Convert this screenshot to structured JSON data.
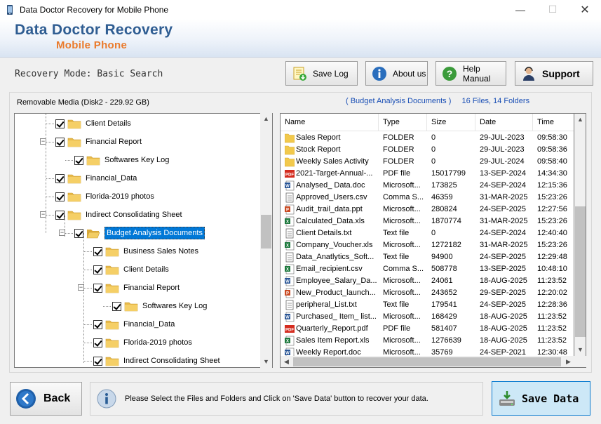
{
  "window": {
    "title": "Data Doctor Recovery for Mobile Phone"
  },
  "banner": {
    "brand_line1": "Data Doctor Recovery",
    "brand_line2": "Mobile Phone"
  },
  "toolbar": {
    "mode_text": "Recovery Mode: Basic Search",
    "save_log": "Save Log",
    "about": "About us",
    "help": "Help Manual",
    "support": "Support"
  },
  "panel": {
    "drive_label": "Removable Media (Disk2 - 229.92 GB)",
    "folder_name": "( Budget Analysis Documents )",
    "folder_counts": "16 Files, 14 Folders"
  },
  "tree": [
    {
      "label": "Client Details"
    },
    {
      "label": "Financial Report"
    },
    {
      "label": "Softwares Key Log"
    },
    {
      "label": "Financial_Data"
    },
    {
      "label": "Florida-2019 photos"
    },
    {
      "label": "Indirect Consolidating Sheet"
    },
    {
      "label": "Budget Analysis Documents"
    },
    {
      "label": "Business Sales Notes"
    },
    {
      "label": "Client Details"
    },
    {
      "label": "Financial Report"
    },
    {
      "label": "Softwares Key Log"
    },
    {
      "label": "Financial_Data"
    },
    {
      "label": "Florida-2019 photos"
    },
    {
      "label": "Indirect Consolidating Sheet"
    }
  ],
  "list": {
    "headers": {
      "name": "Name",
      "type": "Type",
      "size": "Size",
      "date": "Date",
      "time": "Time"
    },
    "rows": [
      {
        "icon": "folder",
        "name": "Sales Report",
        "type": "FOLDER",
        "size": "0",
        "date": "29-JUL-2023",
        "time": "09:58:30"
      },
      {
        "icon": "folder",
        "name": "Stock Report",
        "type": "FOLDER",
        "size": "0",
        "date": "29-JUL-2023",
        "time": "09:58:36"
      },
      {
        "icon": "folder",
        "name": "Weekly Sales Activity",
        "type": "FOLDER",
        "size": "0",
        "date": "29-JUL-2024",
        "time": "09:58:40"
      },
      {
        "icon": "pdf",
        "name": "2021-Target-Annual-...",
        "type": "PDF file",
        "size": "15017799",
        "date": "13-SEP-2024",
        "time": "14:34:30"
      },
      {
        "icon": "doc",
        "name": "Analysed_ Data.doc",
        "type": "Microsoft...",
        "size": "173825",
        "date": "24-SEP-2024",
        "time": "12:15:36"
      },
      {
        "icon": "text",
        "name": "Approved_Users.csv",
        "type": "Comma S...",
        "size": "46359",
        "date": "31-MAR-2025",
        "time": "15:23:26"
      },
      {
        "icon": "ppt",
        "name": "Audit_trail_data.ppt",
        "type": "Microsoft...",
        "size": "280824",
        "date": "24-SEP-2025",
        "time": "12:27:56"
      },
      {
        "icon": "xls",
        "name": "Calculated_Data.xls",
        "type": "Microsoft...",
        "size": "1870774",
        "date": "31-MAR-2025",
        "time": "15:23:26"
      },
      {
        "icon": "text",
        "name": "Client Details.txt",
        "type": "Text file",
        "size": "0",
        "date": "24-SEP-2024",
        "time": "12:40:40"
      },
      {
        "icon": "xls",
        "name": "Company_Voucher.xls",
        "type": "Microsoft...",
        "size": "1272182",
        "date": "31-MAR-2025",
        "time": "15:23:26"
      },
      {
        "icon": "text",
        "name": "Data_Anatlytics_Soft...",
        "type": "Text file",
        "size": "94900",
        "date": "24-SEP-2025",
        "time": "12:29:48"
      },
      {
        "icon": "xls",
        "name": "Email_recipient.csv",
        "type": "Comma S...",
        "size": "508778",
        "date": "13-SEP-2025",
        "time": "10:48:10"
      },
      {
        "icon": "doc",
        "name": "Employee_Salary_Da...",
        "type": "Microsoft...",
        "size": "24061",
        "date": "18-AUG-2025",
        "time": "11:23:52"
      },
      {
        "icon": "ppt",
        "name": "New_Product_launch...",
        "type": "Microsoft...",
        "size": "243652",
        "date": "29-SEP-2025",
        "time": "12:20:02"
      },
      {
        "icon": "text",
        "name": "peripheral_List.txt",
        "type": "Text file",
        "size": "179541",
        "date": "24-SEP-2025",
        "time": "12:28:36"
      },
      {
        "icon": "doc",
        "name": "Purchased_ Item_ list...",
        "type": "Microsoft...",
        "size": "168429",
        "date": "18-AUG-2025",
        "time": "11:23:52"
      },
      {
        "icon": "pdf",
        "name": "Quarterly_Report.pdf",
        "type": "PDF file",
        "size": "581407",
        "date": "18-AUG-2025",
        "time": "11:23:52"
      },
      {
        "icon": "xls",
        "name": "Sales Item Report.xls",
        "type": "Microsoft...",
        "size": "1276639",
        "date": "18-AUG-2025",
        "time": "11:23:52"
      },
      {
        "icon": "doc",
        "name": "Weekly Report.doc",
        "type": "Microsoft...",
        "size": "35769",
        "date": "24-SEP-2021",
        "time": "12:30:48"
      }
    ]
  },
  "bottom": {
    "back": "Back",
    "message": "Please Select the Files and Folders and Click on 'Save Data' button to recover your data.",
    "save": "Save Data"
  }
}
